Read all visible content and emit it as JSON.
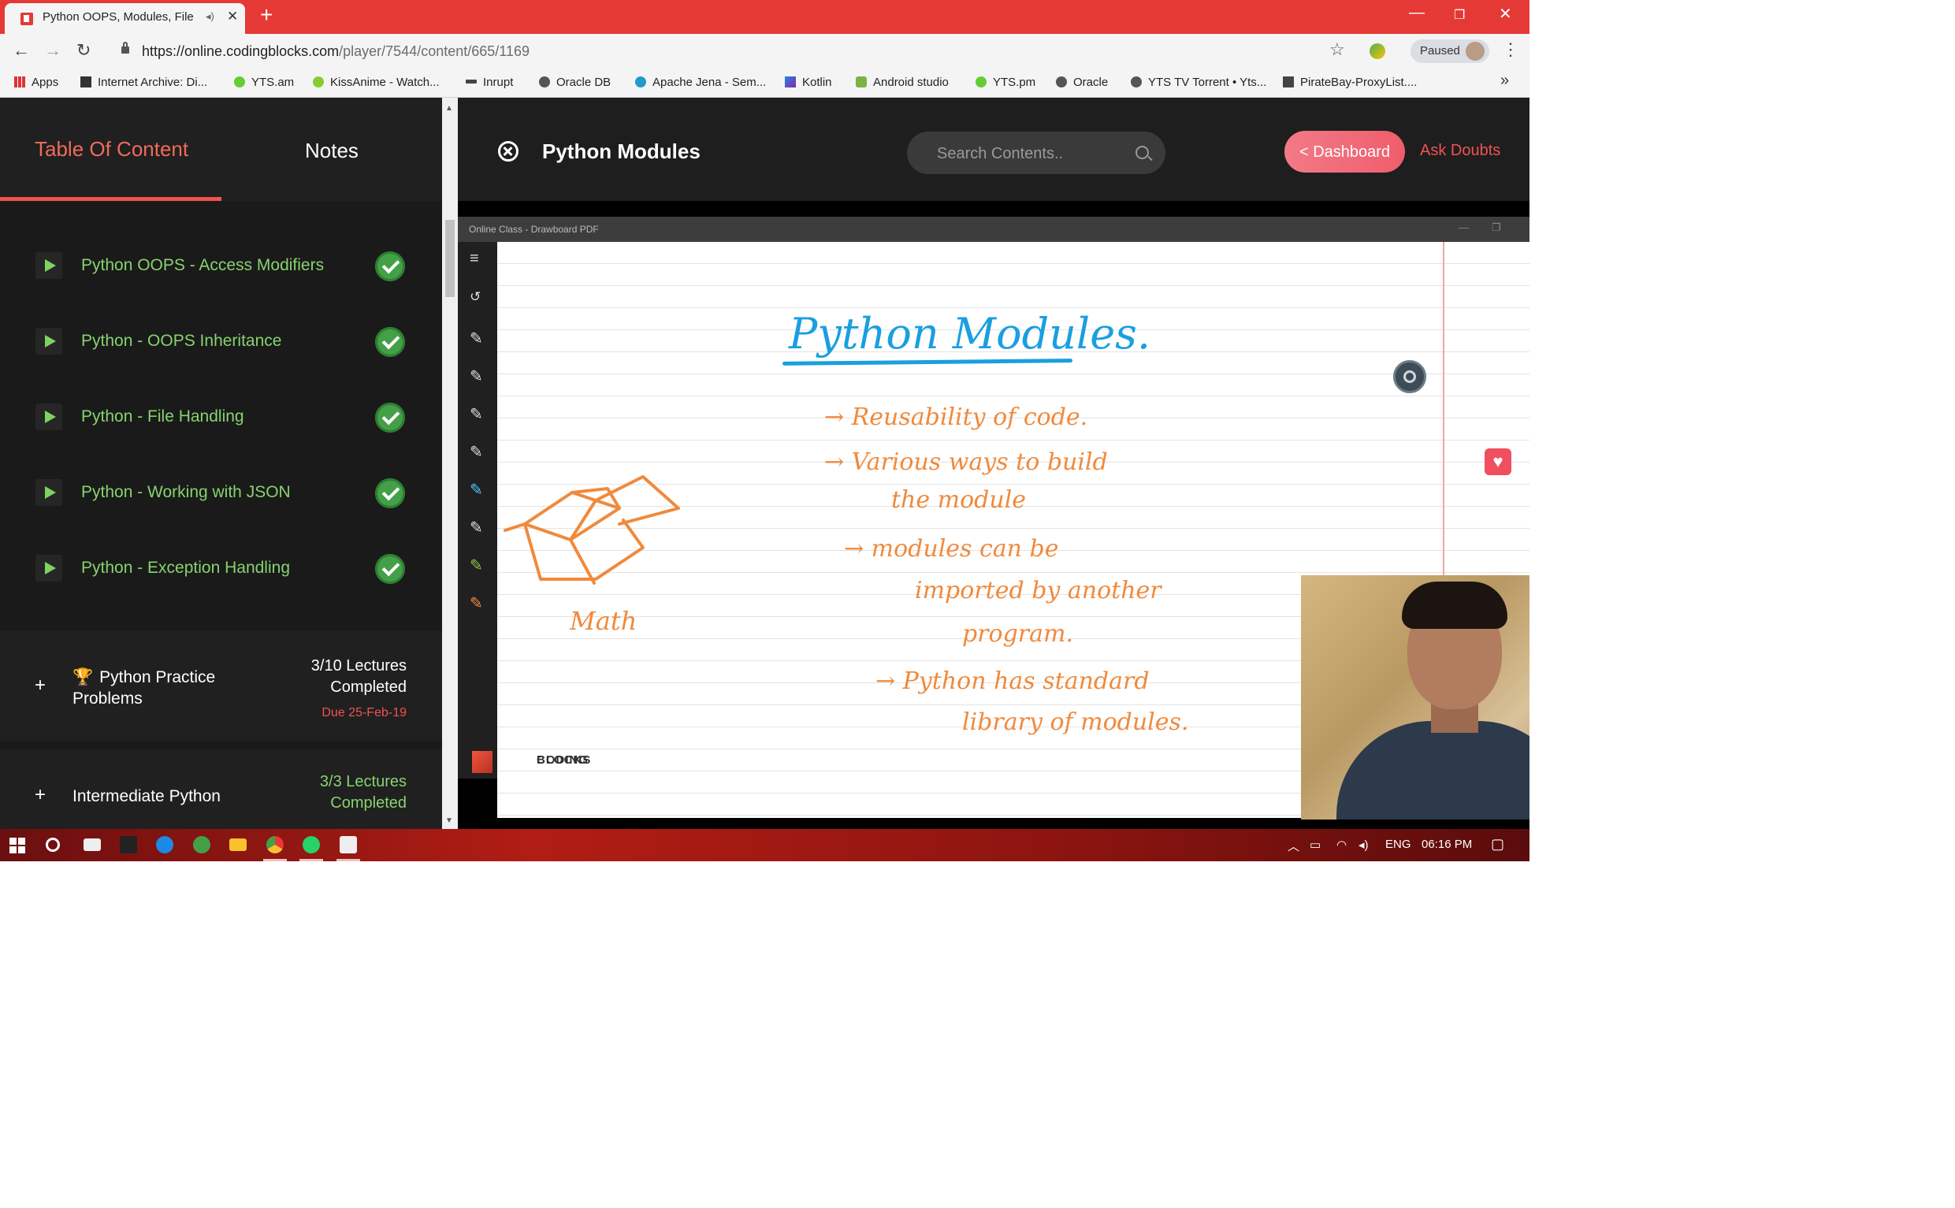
{
  "browser": {
    "tab_title": "Python OOPS, Modules, File",
    "url_host": "https://online.codingblocks.com",
    "url_path": "/player/7544/content/665/1169",
    "profile_status": "Paused",
    "new_tab": "+",
    "bookmarks": [
      "Apps",
      "Internet Archive: Di...",
      "YTS.am",
      "KissAnime - Watch...",
      "Inrupt",
      "Oracle DB",
      "Apache Jena - Sem...",
      "Kotlin",
      "Android studio",
      "YTS.pm",
      "Oracle",
      "YTS TV Torrent • Yts...",
      "PirateBay-ProxyList...."
    ]
  },
  "sidebar": {
    "tab_toc": "Table Of Content",
    "tab_notes": "Notes",
    "lessons": [
      "Python OOPS - Access Modifiers",
      "Python - OOPS Inheritance",
      "Python - File Handling",
      "Python - Working with JSON",
      "Python - Exception Handling"
    ],
    "sections": [
      {
        "title": "Python Practice Problems",
        "count_line1": "3/10 Lectures",
        "count_line2": "Completed",
        "due": "Due 25-Feb-19"
      },
      {
        "title": "Intermediate Python",
        "count_line1": "3/3 Lectures",
        "count_line2": "Completed"
      }
    ]
  },
  "header": {
    "title": "Python Modules",
    "search_placeholder": "Search Contents..",
    "dashboard_label": "< Dashboard",
    "ask_doubts_label": "Ask Doubts"
  },
  "video": {
    "window_title": "Online Class - Drawboard PDF",
    "board_title": "Python Modules.",
    "board_lines": [
      "→ Reusability of code.",
      "→ Various ways to build",
      "the module",
      "→ modules can be",
      "imported by another",
      "program.",
      "→ Python has standard",
      "library of modules."
    ],
    "box_label": "Math",
    "logo_line1": "CODING",
    "logo_line2": "BLOCKS"
  },
  "taskbar": {
    "lang": "ENG",
    "time": "06:16 PM"
  },
  "colors": {
    "accent_red": "#ef5350",
    "complete_green": "#86d36e",
    "ink_blue": "#1a9fe0",
    "ink_orange": "#f08a3c"
  }
}
